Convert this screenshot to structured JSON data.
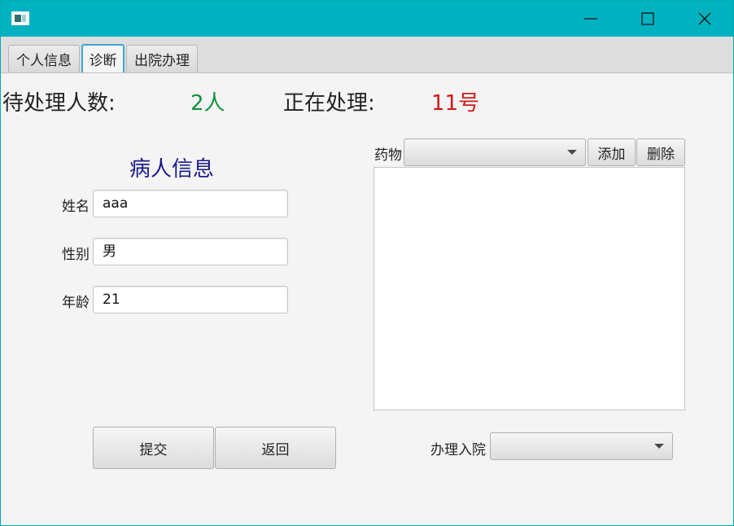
{
  "tabs": [
    {
      "label": "个人信息"
    },
    {
      "label": "诊断"
    },
    {
      "label": "出院办理"
    }
  ],
  "status": {
    "waiting_label": "待处理人数:",
    "waiting_value": "2人",
    "waiting_color": "#13923f",
    "current_label": "正在处理:",
    "current_value": "11号",
    "current_color": "#d01a1a"
  },
  "patient": {
    "title": "病人信息",
    "title_color": "#1a1a8c",
    "fields": [
      {
        "label": "姓名",
        "value": "aaa"
      },
      {
        "label": "性别",
        "value": "男"
      },
      {
        "label": "年龄",
        "value": "21"
      }
    ]
  },
  "medicine": {
    "label": "药物",
    "selected": "",
    "add_label": "添加",
    "delete_label": "删除",
    "items": []
  },
  "actions": {
    "submit_label": "提交",
    "back_label": "返回"
  },
  "admission": {
    "label": "办理入院",
    "selected": ""
  },
  "window_controls": {
    "minimize": "minimize-icon",
    "maximize": "maximize-icon",
    "close": "close-icon"
  }
}
